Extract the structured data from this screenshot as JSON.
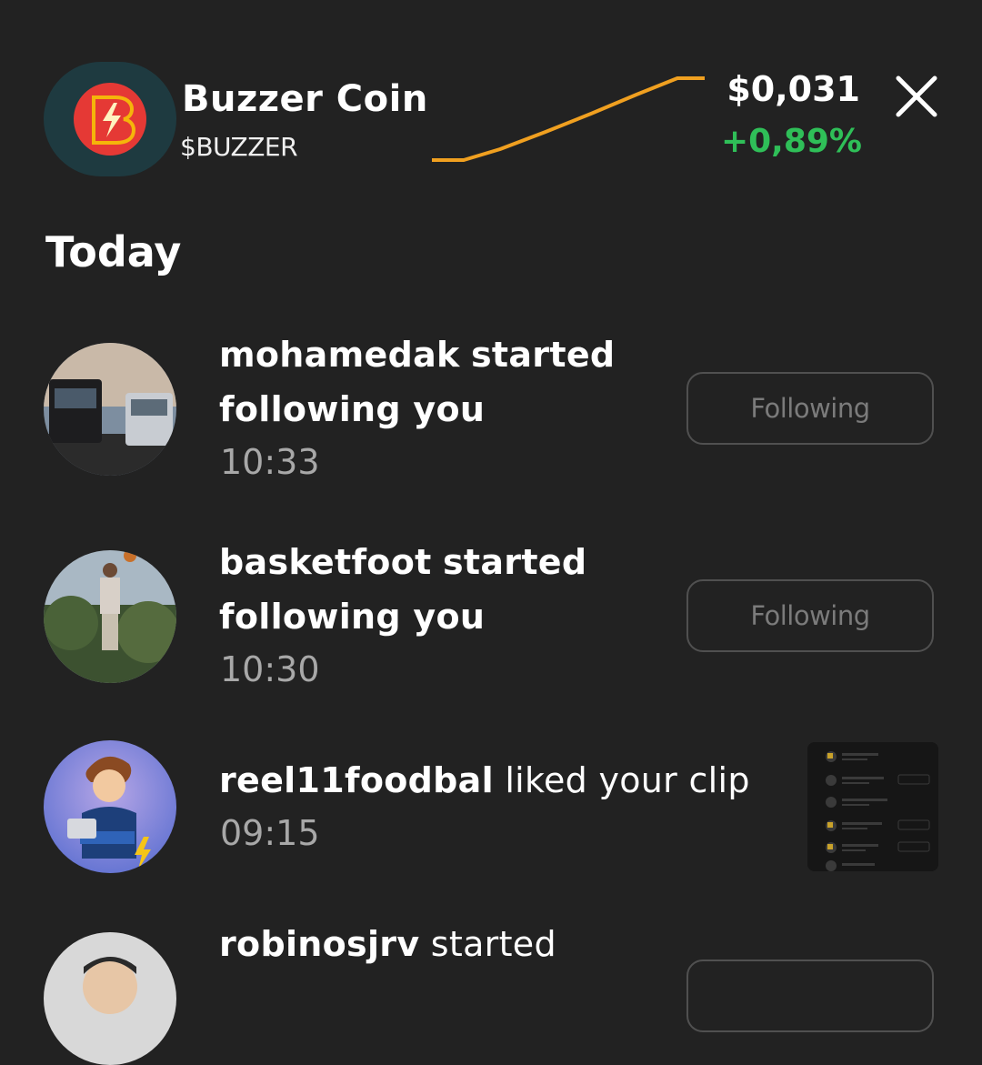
{
  "coin": {
    "name": "Buzzer Coin",
    "ticker": "$BUZZER",
    "price": "$0,031",
    "change": "+0,89%",
    "accent_color": "#f0a020",
    "change_color": "#2fbf58",
    "logo_icon": "buzzer-lightning-b-logo",
    "close_icon": "close-x-icon"
  },
  "section_title": "Today",
  "notifications": [
    {
      "user": "mohamedak",
      "action": "started",
      "action_line2": "following you",
      "time": "10:33",
      "button": "Following",
      "avatar_icon": "trucks-photo-avatar"
    },
    {
      "user": "basketfoot",
      "action": "started",
      "action_line2": "following you",
      "time": "10:30",
      "button": "Following",
      "avatar_icon": "basketball-player-photo-avatar"
    },
    {
      "user": "reel11foodbal",
      "action": "liked your clip",
      "time": "09:15",
      "avatar_icon": "cartoon-boy-avatar",
      "thumbnail_icon": "clip-screenshot-thumbnail"
    },
    {
      "user": "robinosjrv",
      "action": "started",
      "avatar_icon": "person-photo-avatar"
    }
  ]
}
